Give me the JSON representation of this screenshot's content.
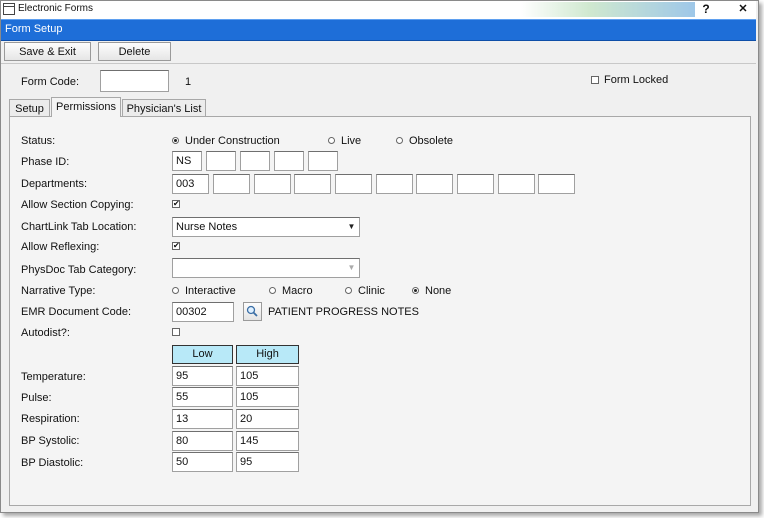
{
  "window": {
    "title": "Electronic Forms",
    "help_glyph": "?",
    "close_glyph": "✕",
    "section_title": "Form Setup"
  },
  "toolbar": {
    "save_exit": "Save & Exit",
    "delete": "Delete"
  },
  "form": {
    "code_label": "Form Code:",
    "code_value": "",
    "code_number": "1",
    "locked_label": "Form Locked",
    "locked": false
  },
  "tabs": [
    {
      "label": "Setup",
      "active": false
    },
    {
      "label": "Permissions",
      "active": true
    },
    {
      "label": "Physician's List",
      "active": false
    }
  ],
  "permissions": {
    "status": {
      "label": "Status:",
      "options": [
        "Under Construction",
        "Live",
        "Obsolete"
      ],
      "selected": "Under Construction"
    },
    "phase_id": {
      "label": "Phase ID:",
      "values": [
        "NS",
        "",
        "",
        "",
        ""
      ]
    },
    "departments": {
      "label": "Departments:",
      "values": [
        "003",
        "",
        "",
        "",
        "",
        "",
        "",
        "",
        "",
        ""
      ]
    },
    "allow_section_copying": {
      "label": "Allow Section Copying:",
      "checked": true,
      "mark": "✔"
    },
    "chartlink_tab": {
      "label": "ChartLink Tab Location:",
      "value": "Nurse Notes",
      "arrow": "▼"
    },
    "allow_reflexing": {
      "label": "Allow Reflexing:",
      "checked": true,
      "mark": "✔"
    },
    "physdoc_tab": {
      "label": "PhysDoc Tab Category:",
      "value": "",
      "arrow": "▼"
    },
    "narrative_type": {
      "label": "Narrative Type:",
      "options": [
        "Interactive",
        "Macro",
        "Clinic",
        "None"
      ],
      "selected": "None"
    },
    "emr_doc_code": {
      "label": "EMR Document Code:",
      "value": "00302",
      "description": "PATIENT PROGRESS NOTES",
      "search_icon": "magnifier-icon"
    },
    "autodist": {
      "label": "Autodist?:",
      "checked": false
    },
    "vitals": {
      "low_header": "Low",
      "high_header": "High",
      "rows": [
        {
          "label": "Temperature:",
          "low": "95",
          "high": "105"
        },
        {
          "label": "Pulse:",
          "low": "55",
          "high": "105"
        },
        {
          "label": "Respiration:",
          "low": "13",
          "high": "20"
        },
        {
          "label": "BP Systolic:",
          "low": "80",
          "high": "145"
        },
        {
          "label": "BP Diastolic:",
          "low": "50",
          "high": "95"
        }
      ]
    }
  }
}
